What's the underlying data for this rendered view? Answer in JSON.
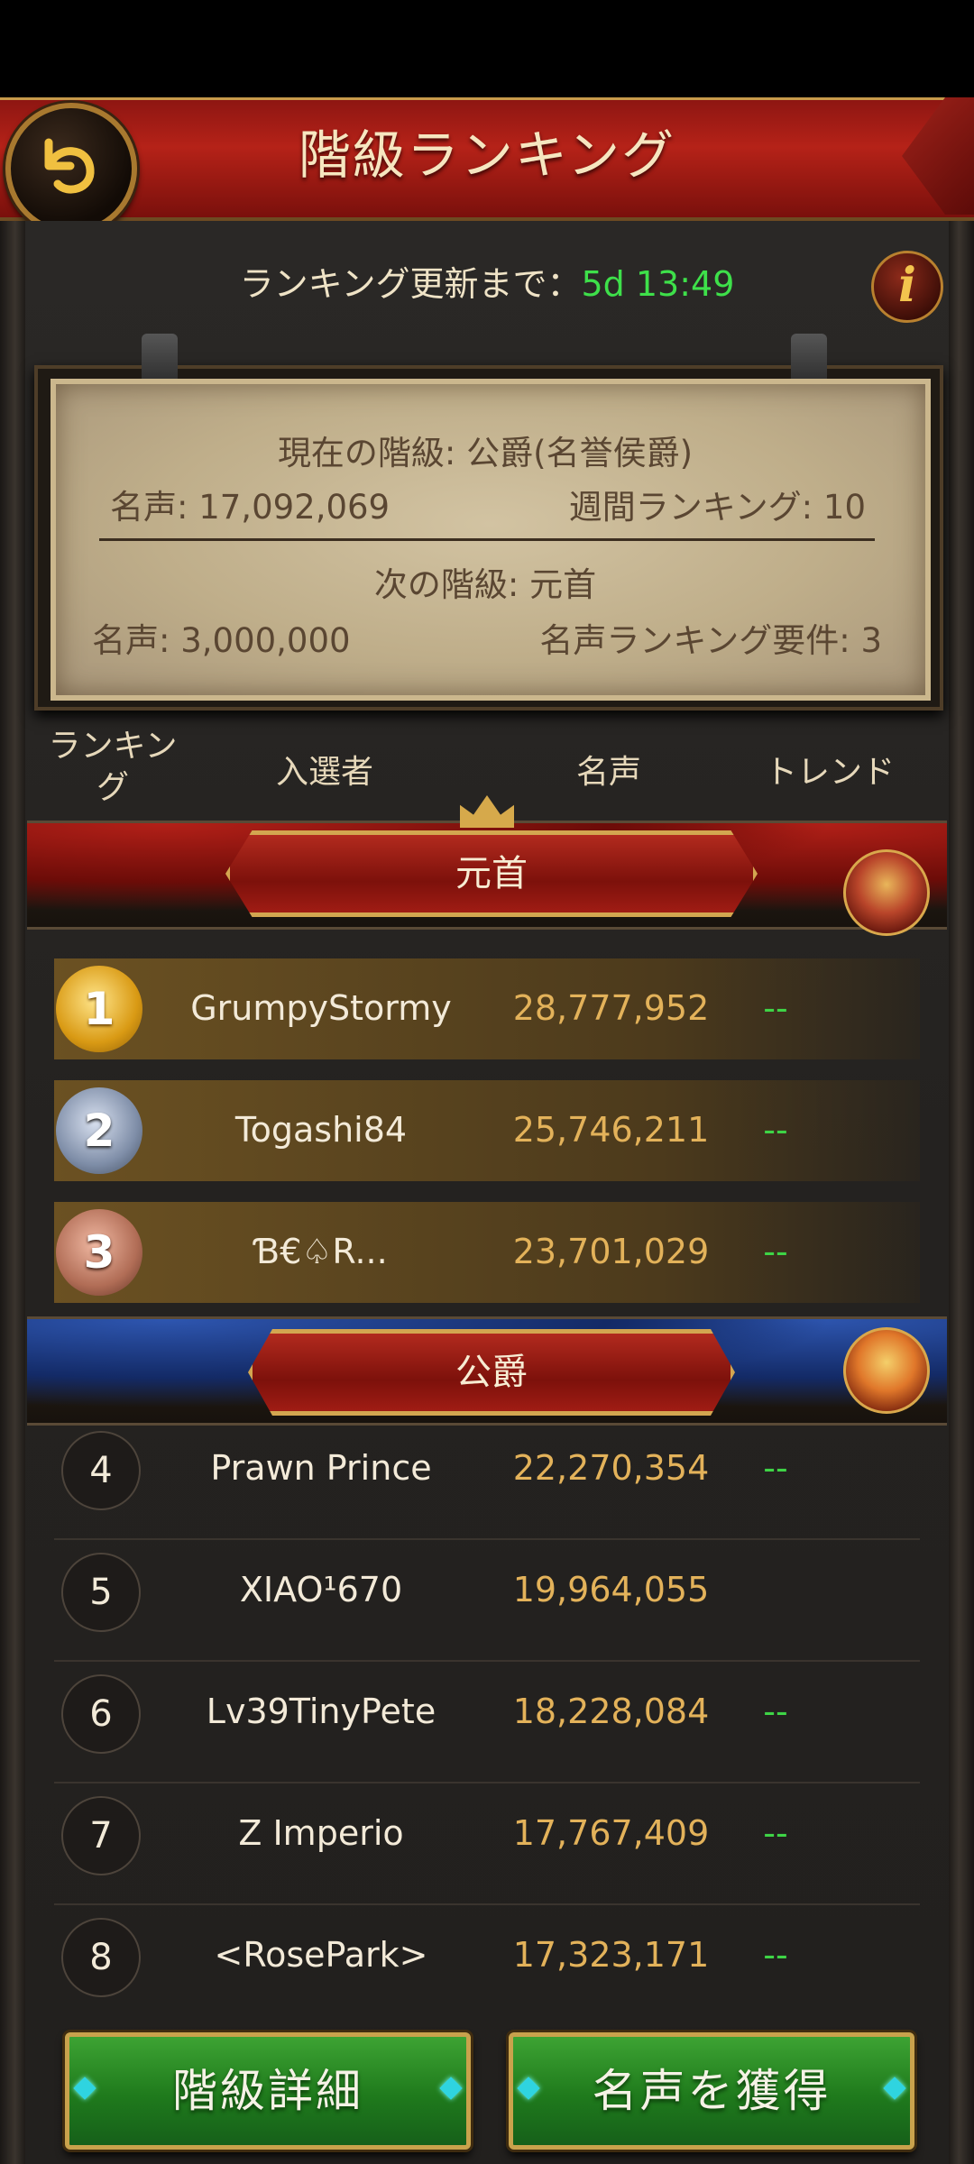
{
  "header": {
    "title": "階級ランキング"
  },
  "timer": {
    "label": "ランキング更新まで：",
    "value": "5d 13:49"
  },
  "status": {
    "current_label": "現在の階級: 公爵(名誉侯爵)",
    "fame": "名声: 17,092,069",
    "weekly_rank": "週間ランキング: 10",
    "next_label": "次の階級: 元首",
    "next_fame": "名声: 3,000,000",
    "next_rank_req": "名声ランキング要件: 3"
  },
  "columns": {
    "rank_line1": "ランキン",
    "rank_line2": "グ",
    "player": "入選者",
    "fame": "名声",
    "trend": "トレンド"
  },
  "tiers": [
    {
      "title": "元首"
    },
    {
      "title": "公爵"
    }
  ],
  "rows": [
    {
      "rank": "1",
      "name": "GrumpyStormy",
      "fame": "28,777,952",
      "trend": "--"
    },
    {
      "rank": "2",
      "name": "Togashi84",
      "fame": "25,746,211",
      "trend": "--"
    },
    {
      "rank": "3",
      "name": "Ɓ€♤R...",
      "fame": "23,701,029",
      "trend": "--"
    },
    {
      "rank": "4",
      "name": "Prawn Prince",
      "fame": "22,270,354",
      "trend": "--"
    },
    {
      "rank": "5",
      "name": "XIAO¹670",
      "fame": "19,964,055",
      "trend": ""
    },
    {
      "rank": "6",
      "name": "Lv39TinyPete",
      "fame": "18,228,084",
      "trend": "--"
    },
    {
      "rank": "7",
      "name": "Z Imperio",
      "fame": "17,767,409",
      "trend": "--"
    },
    {
      "rank": "8",
      "name": "<RosePark>",
      "fame": "17,323,171",
      "trend": "--"
    }
  ],
  "buttons": {
    "details": "階級詳細",
    "earn": "名声を獲得"
  },
  "colors": {
    "timer": "#3ee04a",
    "fame": "#e3b25a",
    "trend": "#3ed446",
    "button": "#2a8f27",
    "header": "#a81d15"
  },
  "icons": {
    "back": "back-arrow-icon",
    "info": "info-icon"
  }
}
